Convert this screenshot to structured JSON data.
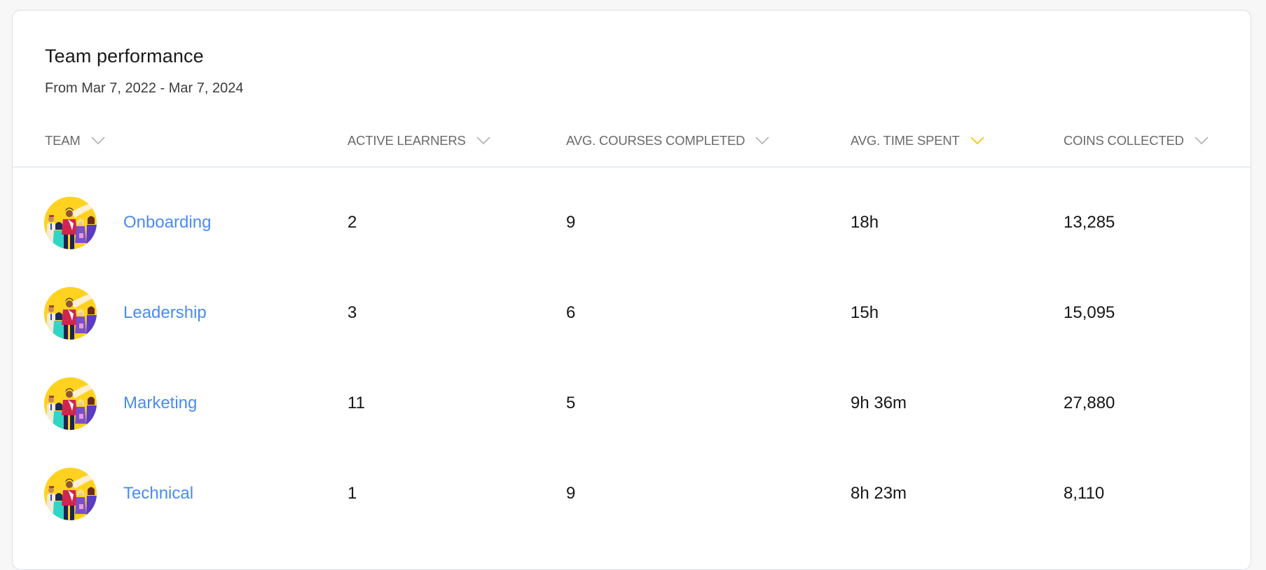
{
  "card": {
    "title": "Team performance",
    "subtitle": "From Mar 7, 2022 - Mar 7, 2024"
  },
  "table": {
    "columns": [
      {
        "label": "TEAM",
        "sort_icon": "chevron-down-icon",
        "active": false
      },
      {
        "label": "ACTIVE LEARNERS",
        "sort_icon": "chevron-down-icon",
        "active": false
      },
      {
        "label": "AVG. COURSES COMPLETED",
        "sort_icon": "chevron-down-icon",
        "active": false
      },
      {
        "label": "AVG. TIME SPENT",
        "sort_icon": "chevron-down-icon",
        "active": true
      },
      {
        "label": "COINS COLLECTED",
        "sort_icon": "chevron-down-icon",
        "active": false
      }
    ],
    "rows": [
      {
        "team": "Onboarding",
        "active_learners": "2",
        "avg_courses_completed": "9",
        "avg_time_spent": "18h",
        "coins_collected": "13,285",
        "avatar": "team-illustration"
      },
      {
        "team": "Leadership",
        "active_learners": "3",
        "avg_courses_completed": "6",
        "avg_time_spent": "15h",
        "coins_collected": "15,095",
        "avatar": "team-illustration"
      },
      {
        "team": "Marketing",
        "active_learners": "11",
        "avg_courses_completed": "5",
        "avg_time_spent": "9h 36m",
        "coins_collected": "27,880",
        "avatar": "team-illustration"
      },
      {
        "team": "Technical",
        "active_learners": "1",
        "avg_courses_completed": "9",
        "avg_time_spent": "8h 23m",
        "coins_collected": "8,110",
        "avatar": "team-illustration"
      }
    ]
  },
  "colors": {
    "link": "#4a8bf0",
    "active_sort": "#f5c800",
    "inactive_sort": "#b5b5b5",
    "avatar_bg": "#ffd21f"
  }
}
